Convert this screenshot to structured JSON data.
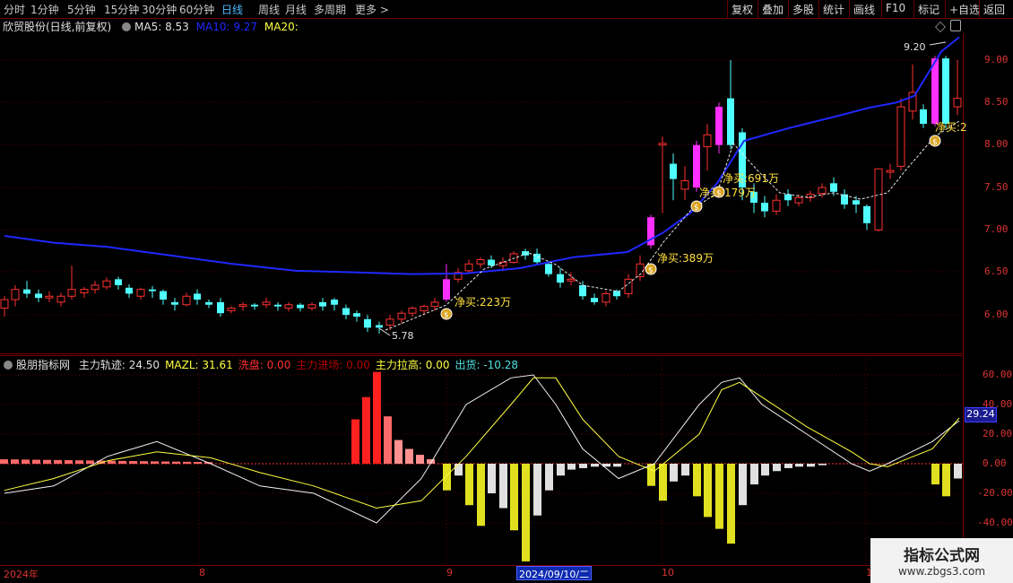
{
  "toolbar": {
    "periods": [
      "分时",
      "1分钟",
      "5分钟",
      "15分钟",
      "30分钟",
      "60分钟",
      "日线",
      "周线",
      "月线",
      "多周期",
      "更多 >"
    ],
    "active_period": "日线",
    "right_buttons": [
      "复权",
      "叠加",
      "多股",
      "统计",
      "画线",
      "F10",
      "标记",
      "+自选",
      "返回"
    ]
  },
  "main_info": {
    "stock": "欣贸股份(日线,前复权)",
    "ma5_label": "MA5: 8.53",
    "ma10_label": "MA10: 9.27",
    "ma20_label": "MA20:"
  },
  "indicator_info": {
    "name": "股朋指标网",
    "items": [
      {
        "text": "主力轨迹: 24.50",
        "color": "#e0e0e0"
      },
      {
        "text": "MAZL: 31.61",
        "color": "#ffff40"
      },
      {
        "text": "洗盘: 0.00",
        "color": "#ff3030"
      },
      {
        "text": "主力进场: 0.00",
        "color": "#b00000"
      },
      {
        "text": "主力拉高: 0.00",
        "color": "#ffff40"
      },
      {
        "text": "出货: -10.28",
        "color": "#50e0e0"
      }
    ]
  },
  "price_axis": [
    "9.00",
    "8.50",
    "8.00",
    "7.50",
    "7.00",
    "6.50",
    "6.00"
  ],
  "indicator_axis": [
    "60.00",
    "40.00",
    "20.00",
    "0.00",
    "-20.00",
    "-40.00"
  ],
  "indicator_current": "29.24",
  "date_axis": {
    "labels": [
      "2024年",
      "8",
      "9",
      "10",
      "1"
    ],
    "cursor": "2024/09/10/二"
  },
  "annotations": {
    "low": "5.78",
    "high": "9.20",
    "buys": [
      "净买:223万",
      "净买:389万",
      "净买:179万",
      "净买:691万",
      "净买:2"
    ]
  },
  "watermark": {
    "title": "指标公式网",
    "url": "www.zbgs3.com"
  },
  "colors": {
    "up": "#ff3030",
    "down": "#50ffff",
    "ma_blue": "#1f28ff",
    "zero_line": "#ff3030"
  },
  "chart_data": [
    {
      "type": "candlestick",
      "title": "欣贸股份(日线,前复权)",
      "ylim": [
        5.55,
        9.45
      ],
      "series": [
        {
          "name": "MA10",
          "values": [
            6.93,
            6.85,
            6.8,
            6.7,
            6.6,
            6.52,
            6.5,
            6.48,
            6.49,
            6.55,
            6.68,
            6.74,
            6.97,
            7.2,
            7.55,
            8.05,
            8.2,
            8.33,
            8.44,
            8.5,
            8.58,
            9.1,
            9.27
          ]
        }
      ]
    },
    {
      "type": "bar",
      "title": "股朋指标网",
      "ylim": [
        -50,
        70
      ],
      "series": [
        {
          "name": "主力轨迹",
          "values": [
            -20,
            -15,
            5,
            15,
            0,
            -15,
            -20,
            -40,
            -10,
            40,
            58,
            60,
            40,
            10,
            -10,
            0,
            40,
            55,
            58,
            40,
            20,
            0,
            -5,
            0,
            15,
            29
          ]
        },
        {
          "name": "MAZL",
          "values": [
            -18,
            -10,
            2,
            8,
            4,
            -6,
            -15,
            -30,
            -25,
            5,
            40,
            58,
            58,
            30,
            5,
            -5,
            20,
            50,
            55,
            45,
            25,
            8,
            0,
            -2,
            10,
            31
          ]
        }
      ]
    }
  ]
}
